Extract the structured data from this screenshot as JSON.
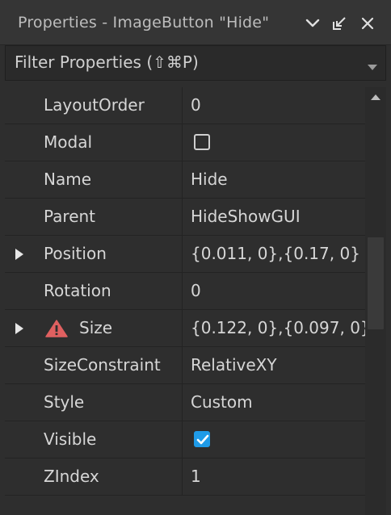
{
  "window": {
    "title": "Properties - ImageButton \"Hide\""
  },
  "filter": {
    "label": "Filter Properties (⇧⌘P)"
  },
  "properties": [
    {
      "name": "LayoutOrder",
      "value": "0"
    },
    {
      "name": "Modal",
      "value_type": "checkbox",
      "checked": false
    },
    {
      "name": "Name",
      "value": "Hide"
    },
    {
      "name": "Parent",
      "value": "HideShowGUI"
    },
    {
      "name": "Position",
      "value": "{0.011, 0},{0.17, 0}",
      "expandable": true
    },
    {
      "name": "Rotation",
      "value": "0"
    },
    {
      "name": "Size",
      "value": "{0.122, 0},{0.097, 0}",
      "expandable": true,
      "warning": true
    },
    {
      "name": "SizeConstraint",
      "value": "RelativeXY"
    },
    {
      "name": "Style",
      "value": "Custom"
    },
    {
      "name": "Visible",
      "value_type": "checkbox",
      "checked": true
    },
    {
      "name": "ZIndex",
      "value": "1"
    }
  ],
  "colors": {
    "panel_bg": "#2e2e2e",
    "checkbox_checked": "#1f9be8",
    "warning": "#e06060"
  },
  "icons": {
    "dropdown": "chevron-down-icon",
    "dock": "undock-icon",
    "close": "close-icon",
    "filter_caret": "caret-down-icon",
    "expand": "triangle-right-icon",
    "warning": "warning-icon"
  }
}
